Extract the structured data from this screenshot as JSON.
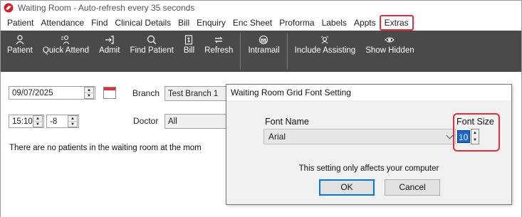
{
  "window": {
    "title": "Waiting Room - Auto-refresh every 35 seconds"
  },
  "menu": [
    "Patient",
    "Attendance",
    "Find",
    "Clinical Details",
    "Bill",
    "Enquiry",
    "Enc Sheet",
    "Proforma",
    "Labels",
    "Appts",
    "Extras"
  ],
  "toolbar": {
    "patient": "Patient",
    "quick_attend": "Quick Attend",
    "admit": "Admit",
    "find_patient": "Find Patient",
    "bill": "Bill",
    "refresh": "Refresh",
    "intramail": "Intramail",
    "include_assisting": "Include Assisting",
    "show_hidden": "Show Hidden"
  },
  "filters": {
    "date": "09/07/2025",
    "time": "15:10",
    "offset": "-8",
    "branch_label": "Branch",
    "branch_value": "Test Branch 1",
    "doctor_label": "Doctor",
    "doctor_value": "All"
  },
  "message": "There are no patients in the waiting room at the mom",
  "dialog": {
    "title": "Waiting Room Grid Font Setting",
    "font_name_label": "Font Name",
    "font_name_value": "Arial",
    "font_size_label": "Font Size",
    "font_size_value": "10",
    "note": "This setting only affects your computer",
    "ok": "OK",
    "cancel": "Cancel"
  },
  "colors": {
    "toolbar_bg": "#4a4a4a",
    "highlight": "#e0303c",
    "selection": "#1a66cc"
  }
}
